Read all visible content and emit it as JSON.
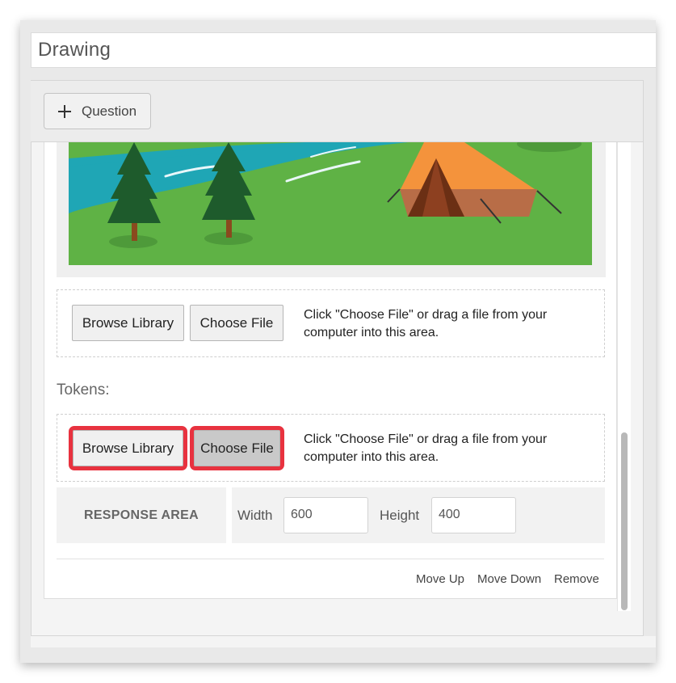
{
  "header": {
    "title_value": "Drawing"
  },
  "toolbar": {
    "add_question_label": "Question",
    "add_question_icon": "plus-icon"
  },
  "background_upload": {
    "browse_label": "Browse Library",
    "choose_label": "Choose File",
    "hint": "Click \"Choose File\" or drag a file from your computer into this area."
  },
  "tokens": {
    "label": "Tokens:",
    "browse_label": "Browse Library",
    "choose_label": "Choose File",
    "hint": "Click \"Choose File\" or drag a file from your computer into this area."
  },
  "response_area": {
    "label": "RESPONSE AREA",
    "width_label": "Width",
    "width_value": "600",
    "height_label": "Height",
    "height_value": "400"
  },
  "footer": {
    "move_up": "Move Up",
    "move_down": "Move Down",
    "remove": "Remove"
  },
  "colors": {
    "highlight": "#e8323f",
    "sky_grass": "#5fb245",
    "river": "#1fa6b5",
    "tent": "#f4933c"
  }
}
